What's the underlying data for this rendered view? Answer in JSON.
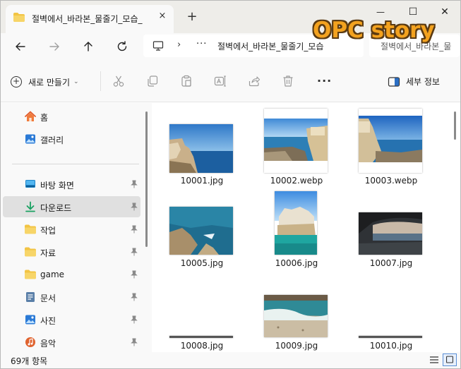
{
  "window": {
    "tab_title": "절벽에서_바라본_물줄기_모습_",
    "close_tab": "×",
    "new_tab": "+",
    "minimize": "—",
    "maximize": "☐",
    "close": "✕"
  },
  "address": {
    "overflow": "···",
    "path": "절벽에서_바라본_물줄기_모습",
    "search_placeholder": "절벽에서_바라본_물"
  },
  "watermark": "OPC story",
  "toolbar": {
    "new_label": "새로 만들기",
    "new_caret": "⌄",
    "more": "···",
    "details_label": "세부 정보"
  },
  "sidebar": {
    "items": [
      {
        "label": "홈",
        "icon": "home-icon"
      },
      {
        "label": "갤러리",
        "icon": "gallery-icon"
      },
      {
        "label": "바탕 화면",
        "icon": "desktop-icon",
        "pinned": true
      },
      {
        "label": "다운로드",
        "icon": "download-icon",
        "pinned": true,
        "selected": true
      },
      {
        "label": "작업",
        "icon": "folder-icon",
        "pinned": true
      },
      {
        "label": "자료",
        "icon": "folder-icon",
        "pinned": true
      },
      {
        "label": "game",
        "icon": "folder-icon",
        "pinned": true
      },
      {
        "label": "문서",
        "icon": "document-icon",
        "pinned": true
      },
      {
        "label": "사진",
        "icon": "pictures-icon",
        "pinned": true
      },
      {
        "label": "음악",
        "icon": "music-icon",
        "pinned": true
      }
    ]
  },
  "files": [
    {
      "name": "10001.jpg"
    },
    {
      "name": "10002.webp"
    },
    {
      "name": "10003.webp"
    },
    {
      "name": "10005.jpg"
    },
    {
      "name": "10006.jpg"
    },
    {
      "name": "10007.jpg"
    },
    {
      "name": "10008.jpg"
    },
    {
      "name": "10009.jpg"
    },
    {
      "name": "10010.jpg"
    }
  ],
  "status": {
    "item_count": "69개 항목"
  },
  "colors": {
    "accent": "#0067c0",
    "folder": "#f2c443",
    "watermark": "#f3a21f"
  }
}
